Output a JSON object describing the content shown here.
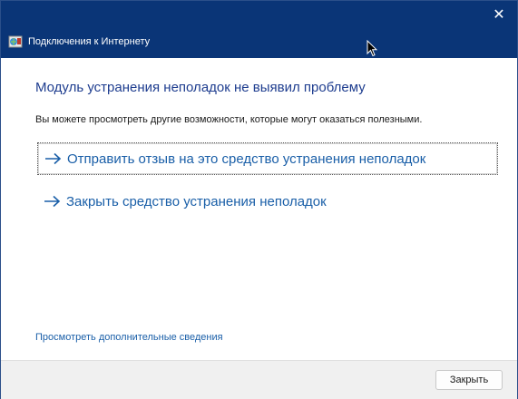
{
  "window": {
    "title": "Подключения к Интернету",
    "close_glyph": "✕"
  },
  "main": {
    "headline": "Модуль устранения неполадок не выявил проблему",
    "subtext": "Вы можете просмотреть другие возможности, которые могут оказаться полезными.",
    "options": [
      {
        "label": "Отправить отзыв на это средство устранения неполадок",
        "icon": "arrow-right-icon",
        "focused": true
      },
      {
        "label": "Закрыть средство устранения неполадок",
        "icon": "arrow-right-icon",
        "focused": false
      }
    ],
    "details_link": "Просмотреть дополнительные сведения"
  },
  "footer": {
    "close_button": "Закрыть"
  },
  "colors": {
    "titlebar": "#0a3577",
    "headline": "#1e3d8f",
    "link": "#1a5fa8"
  }
}
